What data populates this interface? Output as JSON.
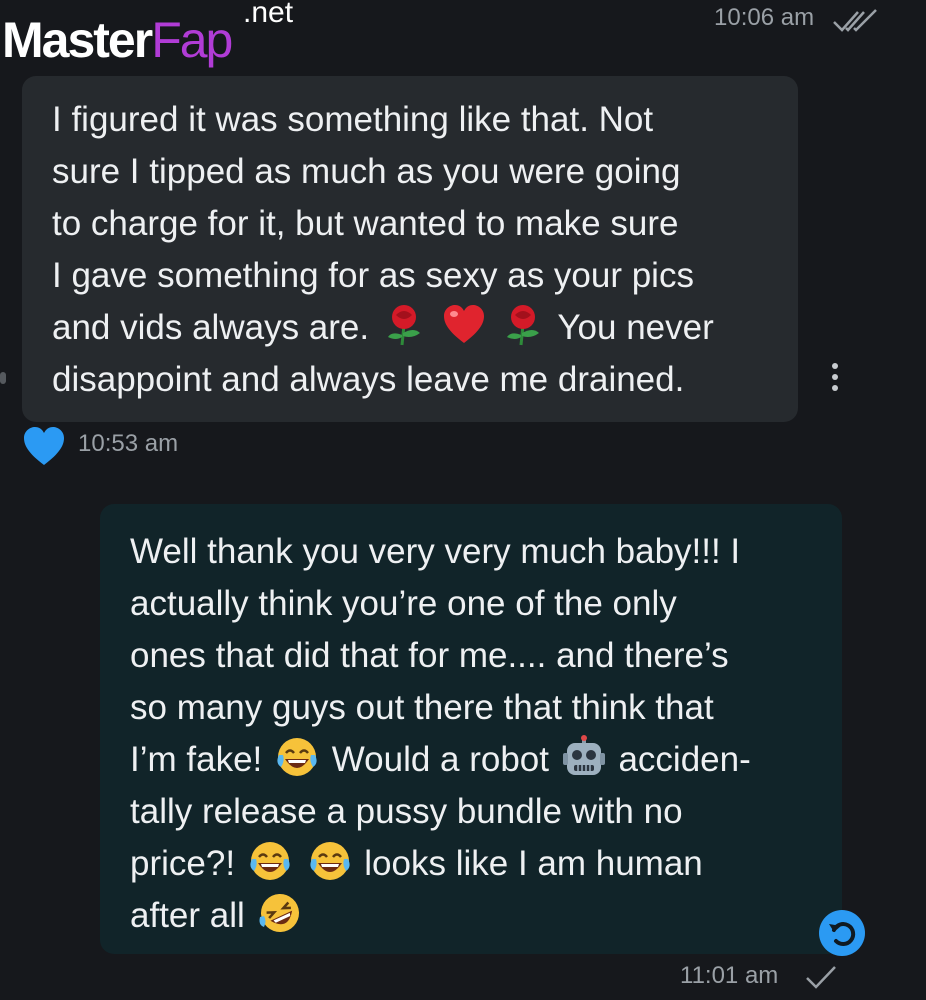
{
  "watermark": {
    "main_part1": "Master",
    "main_part2": "Fap",
    "suffix": ".net"
  },
  "header": {
    "timestamp": "10:06 am",
    "status_icon": "double-check-icon"
  },
  "incoming_message": {
    "lines": [
      {
        "text": "I figured it was something like that. Not"
      },
      {
        "text": "sure I tipped as much as you were going"
      },
      {
        "text": "to charge for it, but wanted to make sure"
      },
      {
        "text": "I gave something for as sexy as your pics"
      },
      {
        "text_before": "and vids always are.",
        "text_after": "You never",
        "emojis": [
          "rose-emoji",
          "red-heart-emoji",
          "rose-emoji"
        ]
      },
      {
        "text": "disappoint and always leave me drained."
      }
    ],
    "reaction_icon": "blue-heart-icon",
    "timestamp": "10:53 am",
    "menu_icon": "more-vertical-icon"
  },
  "outgoing_message": {
    "lines": [
      {
        "text": "Well thank you very very much baby!!! I"
      },
      {
        "text": "actually think you’re one of the only"
      },
      {
        "text": "ones that did that for me.... and there’s"
      },
      {
        "text": "so many guys out there that think that"
      },
      {
        "part1": "I’m fake!",
        "part2": "Would a robot",
        "part3": "acciden-"
      },
      {
        "text": "tally release a pussy bundle with no"
      },
      {
        "part1": "price?!",
        "part2": "looks like I am human"
      },
      {
        "text": "after all"
      }
    ],
    "emojis": [
      "laughing-tears-emoji",
      "robot-emoji",
      "laughing-tears-emoji",
      "laughing-tears-emoji",
      "rolling-laughing-emoji"
    ],
    "action_icon": "undo-icon",
    "timestamp": "11:01 am",
    "status_icon": "check-icon"
  },
  "colors": {
    "background": "#16181c",
    "incoming_bubble": "#262a2e",
    "outgoing_bubble": "#112429",
    "accent_blue": "#2b9af3",
    "watermark_purple": "#b13cd6"
  }
}
